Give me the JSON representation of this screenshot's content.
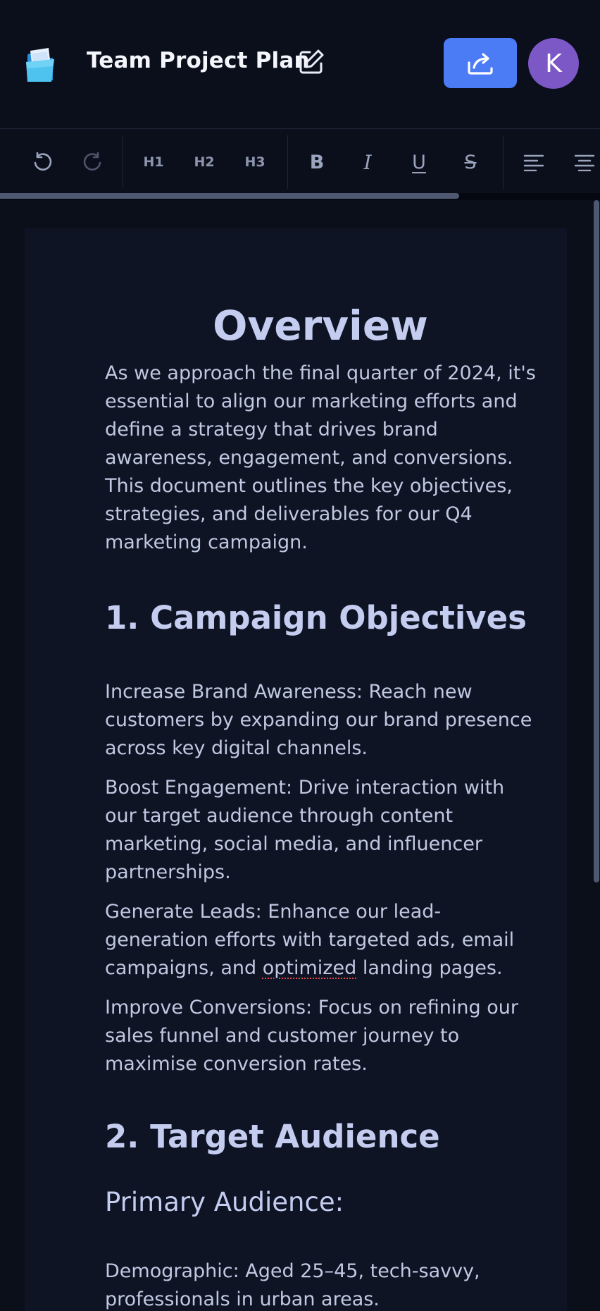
{
  "header": {
    "title": "Team Project Plan",
    "edit_icon": "pencil-square-icon",
    "share_icon": "share-arrow-icon",
    "logo_icon": "folder-logo-icon",
    "avatar_initial": "K",
    "colors": {
      "share_button": "#4b7bf5",
      "avatar": "#7c58c7"
    }
  },
  "toolbar": {
    "undo_icon": "undo-icon",
    "redo_icon": "redo-icon",
    "h1": "H1",
    "h2": "H2",
    "h3": "H3",
    "bold": "B",
    "italic": "I",
    "underline": "U",
    "strike": "S",
    "align_left_icon": "align-left-icon",
    "align_center_icon": "align-center-icon"
  },
  "document": {
    "heading": "Overview",
    "intro": "As we approach the final quarter of 2024, it's essential to align our marketing efforts and define a strategy that drives brand awareness, engagement, and conversions. This document outlines the key objectives, strategies, and deliverables for our Q4 marketing campaign.",
    "section1": {
      "title": "1. Campaign Objectives",
      "items": [
        "Increase Brand Awareness: Reach new customers by expanding our brand presence across key digital channels.",
        "Boost Engagement: Drive interaction with our target audience through content marketing, social media, and influencer partnerships.",
        "Generate Leads: Enhance our lead-generation efforts with targeted ads, email campaigns, and ",
        "Improve Conversions: Focus on refining our sales funnel and customer journey to maximise conversion rates."
      ],
      "misspelled_word": "optimized",
      "item3_tail": " landing pages."
    },
    "section2": {
      "title": "2. Target Audience",
      "subtitle": "Primary Audience:",
      "demographic": "Demographic: Aged 25–45, tech-savvy, professionals in urban areas."
    }
  }
}
